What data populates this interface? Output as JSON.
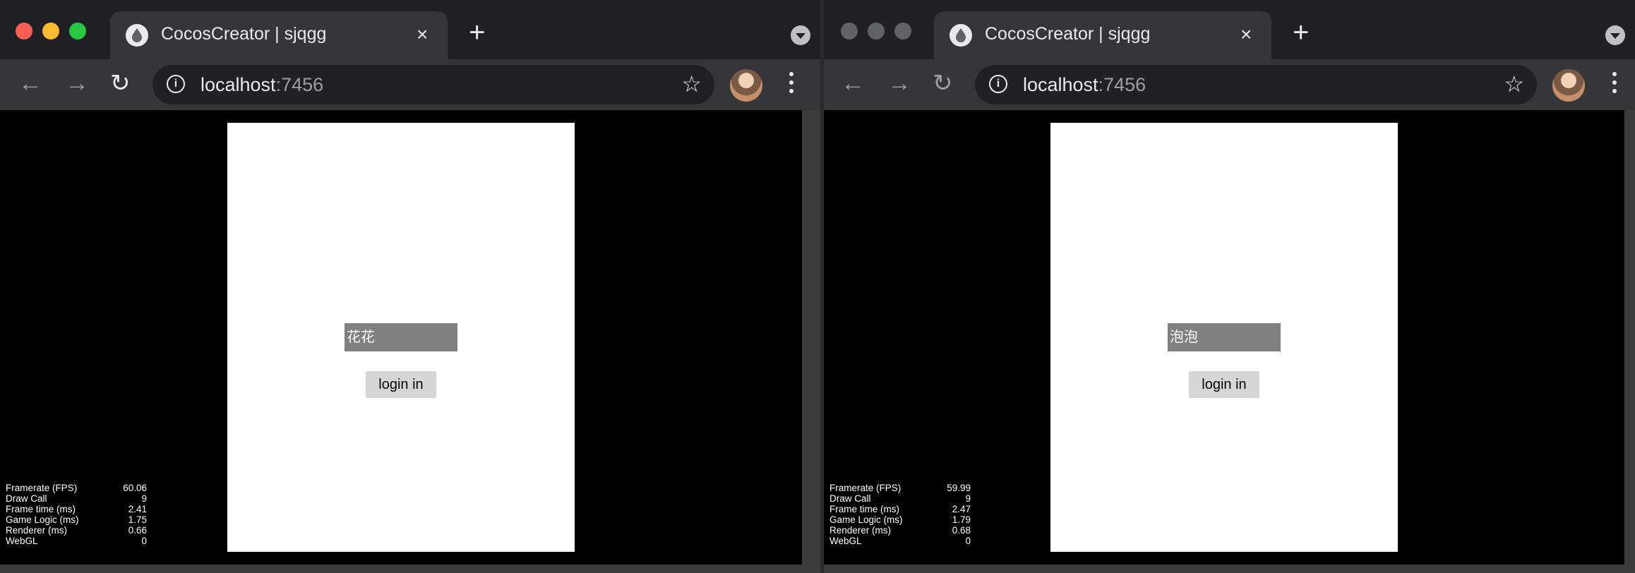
{
  "windows": [
    {
      "tab_title": "CocosCreator | sjqgg",
      "url_host": "localhost",
      "url_port": ":7456",
      "name_value": "花花",
      "login_label": "login in",
      "stats": [
        {
          "label": "Framerate (FPS)",
          "value": "60.06"
        },
        {
          "label": "Draw Call",
          "value": "9"
        },
        {
          "label": "Frame time (ms)",
          "value": "2.41"
        },
        {
          "label": "Game Logic (ms)",
          "value": "1.75"
        },
        {
          "label": "Renderer (ms)",
          "value": "0.66"
        },
        {
          "label": "WebGL",
          "value": "0"
        }
      ]
    },
    {
      "tab_title": "CocosCreator | sjqgg",
      "url_host": "localhost",
      "url_port": ":7456",
      "name_value": "泡泡",
      "login_label": "login in",
      "stats": [
        {
          "label": "Framerate (FPS)",
          "value": "59.99"
        },
        {
          "label": "Draw Call",
          "value": "9"
        },
        {
          "label": "Frame time (ms)",
          "value": "2.47"
        },
        {
          "label": "Game Logic (ms)",
          "value": "1.79"
        },
        {
          "label": "Renderer (ms)",
          "value": "0.68"
        },
        {
          "label": "WebGL",
          "value": "0"
        }
      ]
    }
  ],
  "icons": {
    "tab_close": "×",
    "new_tab": "+",
    "back": "←",
    "forward": "→",
    "reload": "↻",
    "info": "i",
    "star": "☆"
  },
  "colors": {
    "traffic_close": "#ff5f57",
    "traffic_minimize": "#febc2e",
    "traffic_zoom": "#28c840",
    "traffic_inactive": "#5f6368",
    "canvas": "#ffffff",
    "name_box": "#808080",
    "login_button": "#d6d6d6"
  }
}
